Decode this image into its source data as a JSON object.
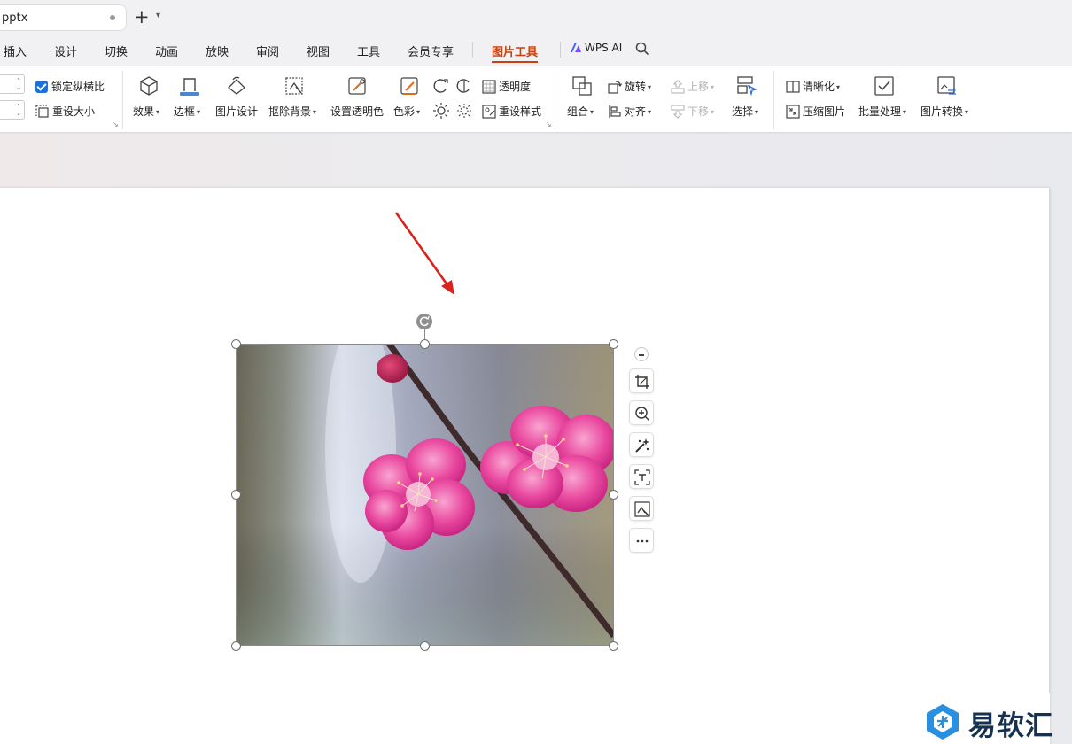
{
  "tab": {
    "doc_name": "pptx"
  },
  "menu": {
    "items": [
      "插入",
      "设计",
      "切换",
      "动画",
      "放映",
      "审阅",
      "视图",
      "工具",
      "会员专享",
      "图片工具"
    ],
    "ai_label": "WPS AI"
  },
  "ribbon": {
    "size_group": {
      "lock_ratio": "锁定纵横比",
      "reset_size": "重设大小"
    },
    "style_group": {
      "effect": "效果",
      "border": "边框",
      "image_design": "图片设计",
      "remove_bg": "抠除背景",
      "set_transparent": "设置透明色",
      "color": "色彩",
      "transparency": "透明度",
      "reset_style": "重设样式"
    },
    "arrange_group": {
      "combine": "组合",
      "rotate": "旋转",
      "align": "对齐",
      "bring_forward": "上移",
      "send_backward": "下移",
      "select": "选择"
    },
    "tools_group": {
      "sharpen": "清晰化",
      "compress": "压缩图片",
      "batch": "批量处理",
      "convert": "图片转换"
    }
  },
  "watermark": {
    "text": "易软汇"
  },
  "colors": {
    "accent": "#c8420f",
    "checkbox": "#1e6fd9",
    "annotation_arrow": "#d9231c",
    "blossom": "#e0409a",
    "watermark_blue": "#2b8fe0"
  }
}
